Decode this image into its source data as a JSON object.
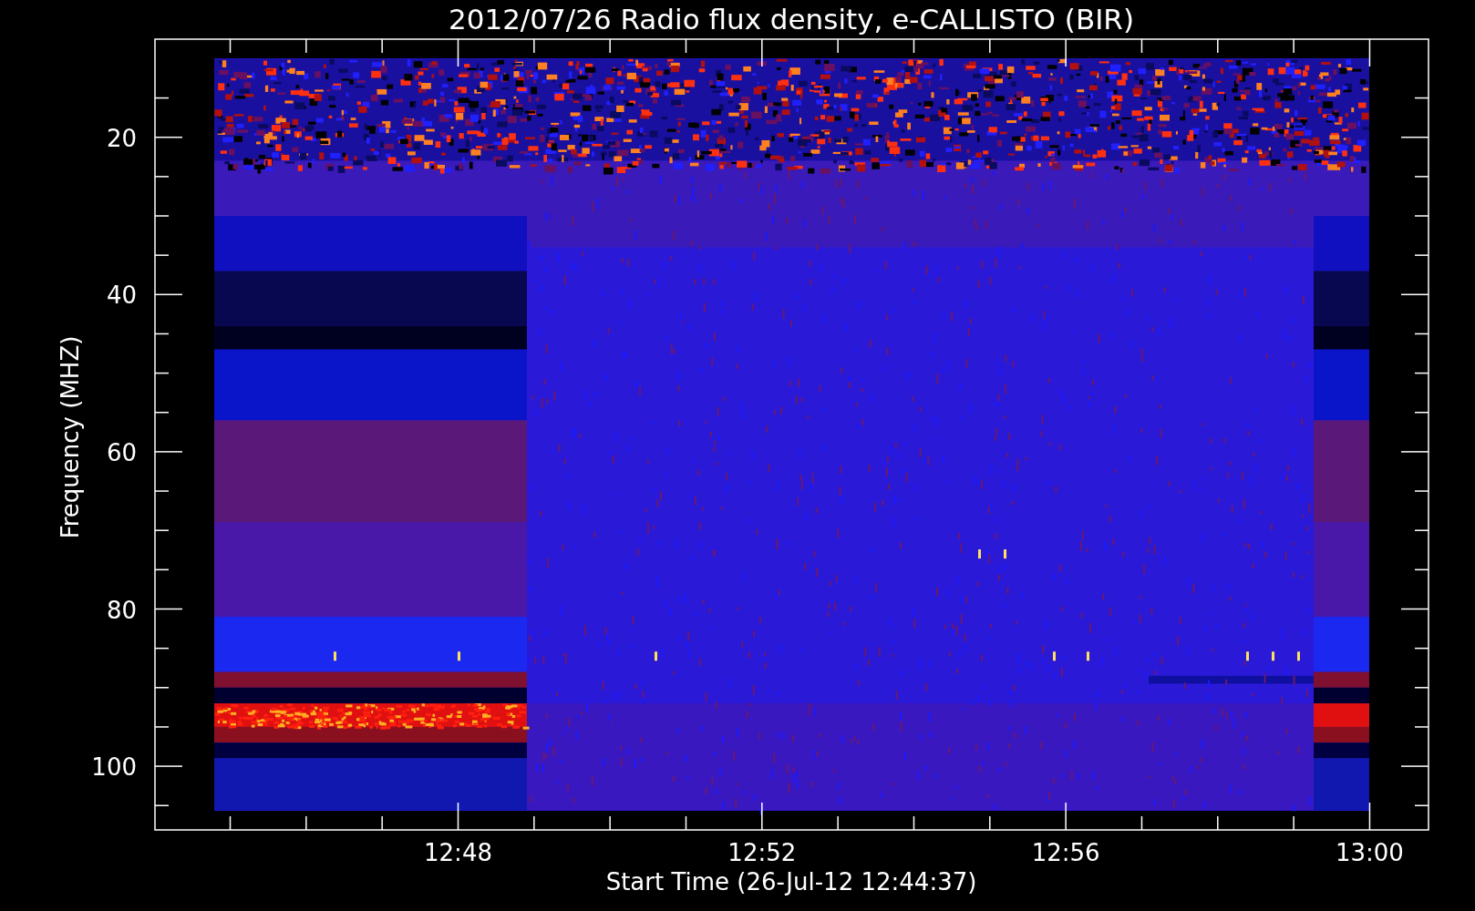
{
  "plot": {
    "title": "2012/07/26  Radio flux density, e-CALLISTO (BIR)",
    "ylabel": "Frequency (MHZ)",
    "xlabel": "Start Time (26-Jul-12 12:44:37)",
    "yticks": [
      "20",
      "40",
      "60",
      "80",
      "100"
    ],
    "xticks": [
      "12:48",
      "12:52",
      "12:56",
      "13:00"
    ]
  }
}
